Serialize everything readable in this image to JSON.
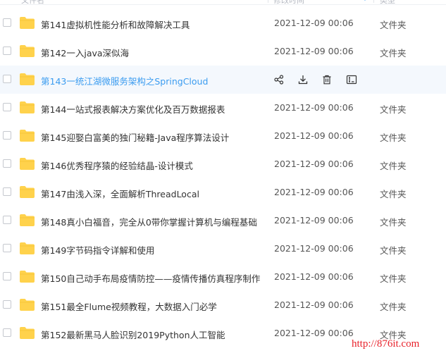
{
  "header": {
    "name_label": "文件名",
    "time_label": "修改时间",
    "type_label": "类型"
  },
  "rows": [
    {
      "name": "第141虚拟机性能分析和故障解决工具",
      "time": "2021-12-09 00:06",
      "type": "文件夹"
    },
    {
      "name": "第142一入java深似海",
      "time": "2021-12-09 00:06",
      "type": "文件夹"
    },
    {
      "name": "第143一统江湖微服务架构之SpringCloud",
      "time": "",
      "type": ""
    },
    {
      "name": "第144一站式报表解决方案优化及百万数据报表",
      "time": "2021-12-09 00:06",
      "type": "文件夹"
    },
    {
      "name": "第145迎娶白富美的独门秘籍-Java程序算法设计",
      "time": "2021-12-09 00:06",
      "type": "文件夹"
    },
    {
      "name": "第146优秀程序猿的经验结晶-设计模式",
      "time": "2021-12-09 00:06",
      "type": "文件夹"
    },
    {
      "name": "第147由浅入深，全面解析ThreadLocal",
      "time": "2021-12-09 00:06",
      "type": "文件夹"
    },
    {
      "name": "第148真小白福音，完全从0带你掌握计算机与编程基础",
      "time": "2021-12-09 00:06",
      "type": "文件夹"
    },
    {
      "name": "第149字节码指令详解和使用",
      "time": "2021-12-09 00:06",
      "type": "文件夹"
    },
    {
      "name": "第150自己动手布局疫情防控——疫情传播仿真程序制作",
      "time": "2021-12-09 00:06",
      "type": "文件夹"
    },
    {
      "name": "第151最全Flume视频教程，大数据入门必学",
      "time": "2021-12-09 00:06",
      "type": "文件夹"
    },
    {
      "name": "第152最新黑马人脸识别2019Python人工智能",
      "time": "2021-12-09 00:06",
      "type": "文件夹"
    }
  ],
  "hover_actions": [
    "share-icon",
    "download-icon",
    "delete-icon",
    "rename-icon"
  ],
  "watermark": "http://876it.com",
  "colors": {
    "folder": "#ffd24c",
    "link": "#3b9cf0",
    "hover_bg": "#f4f8fd",
    "watermark": "#e8222b"
  }
}
